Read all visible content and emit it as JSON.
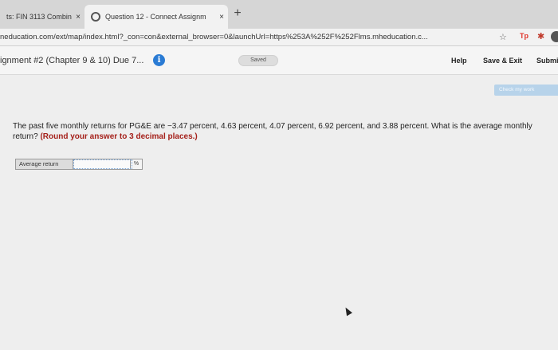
{
  "tabs": [
    {
      "title": "ts: FIN 3113 Combin",
      "close": "×"
    },
    {
      "title": "Question 12 - Connect Assignm",
      "close": "×"
    }
  ],
  "new_tab": "+",
  "url": "neducation.com/ext/map/index.html?_con=con&external_browser=0&launchUrl=https%253A%252F%252Flms.mheducation.c...",
  "toolbar": {
    "star": "☆",
    "tp": "Tp",
    "ext": "✱"
  },
  "header": {
    "assignment_title": "ignment #2 (Chapter 9 & 10) Due 7...",
    "info": "i",
    "saved": "Saved",
    "help": "Help",
    "save_exit": "Save & Exit",
    "submit": "Submi"
  },
  "check_my_work": "Check my work",
  "question": {
    "text": "The past five monthly returns for PG&E are −3.47 percent, 4.63 percent, 4.07 percent, 6.92 percent, and 3.88 percent. What is the average monthly return?",
    "emphasis": "(Round your answer to 3 decimal places.)"
  },
  "answer": {
    "label": "Average return",
    "value": "",
    "unit": "%"
  },
  "colors": {
    "accent": "#2a7bd4",
    "emphasis": "#a5211b",
    "check_button": "#b7d3ea"
  }
}
